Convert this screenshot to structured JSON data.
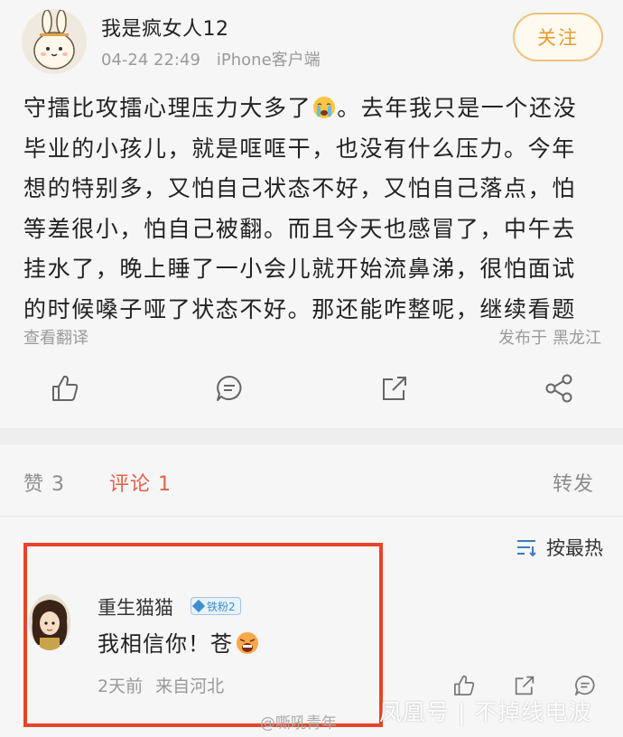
{
  "post": {
    "username": "我是疯女人12",
    "date": "04-24 22:49",
    "source": "iPhone客户端",
    "follow_label": "关注",
    "content_lines": [
      "守擂比攻擂心理压力大多了",
      "。去年我只是一个还没",
      "毕业的小孩儿，就是哐哐干，也没有什么压力。今年",
      "想的特别多，又怕自己状态不好，又怕自己落点，怕",
      "等差很小，怕自己被翻。而且今天也感冒了，中午去",
      "挂水了，晚上睡了一小会儿就开始流鼻涕，很怕面试",
      "的时候嗓子哑了状态不好。那还能咋整呢，继续看题"
    ],
    "translate_label": "查看翻译",
    "location_prefix": "发布于",
    "location": "黑龙江",
    "actions": [
      "like-icon",
      "comment-icon",
      "repost-icon",
      "share-icon"
    ]
  },
  "tabs": {
    "likes": "赞 3",
    "comments": "评论 1",
    "reposts": "转发"
  },
  "comments": {
    "sort_label": "按最热",
    "items": [
      {
        "name": "重生猫猫",
        "badge": "铁粉2",
        "text": "我相信你！苍",
        "time": "2天前",
        "from": "来自河北"
      }
    ]
  },
  "watermark": {
    "weibo": "@嘶吼青年",
    "right": "凤凰号 | 不掉线电波"
  },
  "colors": {
    "accent": "#e3614a",
    "follow": "#e89a2d",
    "highlight_border": "#e8432b"
  }
}
